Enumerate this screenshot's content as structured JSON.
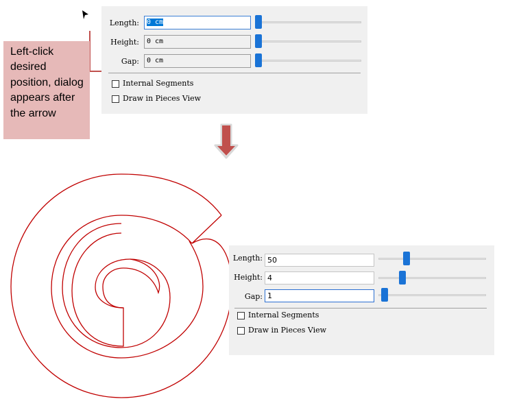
{
  "step1": {
    "dialog": {
      "length": {
        "label": "Length:",
        "value": "0 cm",
        "selected": true
      },
      "height": {
        "label": "Height:",
        "value": "0 cm"
      },
      "gap": {
        "label": "Gap:",
        "value": "0 cm"
      },
      "internal_segments": {
        "label": "Internal Segments",
        "checked": false
      },
      "draw_in_pieces": {
        "label": "Draw in Pieces View",
        "checked": false
      }
    },
    "callout": "Left-click desired position, dialog appears after the arrow"
  },
  "step2": {
    "dialog": {
      "length": {
        "label": "Length:",
        "value": "50"
      },
      "height": {
        "label": "Height:",
        "value": "4"
      },
      "gap": {
        "label": "Gap:",
        "value": "1"
      },
      "internal_segments": {
        "label": "Internal Segments",
        "checked": false
      },
      "draw_in_pieces": {
        "label": "Draw in Pieces View",
        "checked": false
      }
    }
  },
  "colors": {
    "dialog_bg": "#f0f0f0",
    "slider_thumb": "#1a73d6",
    "callout_bg": "#e6b9b8",
    "callout_line": "#c0504d",
    "spiral_stroke": "#c00000",
    "down_arrow": "#c0504d"
  }
}
